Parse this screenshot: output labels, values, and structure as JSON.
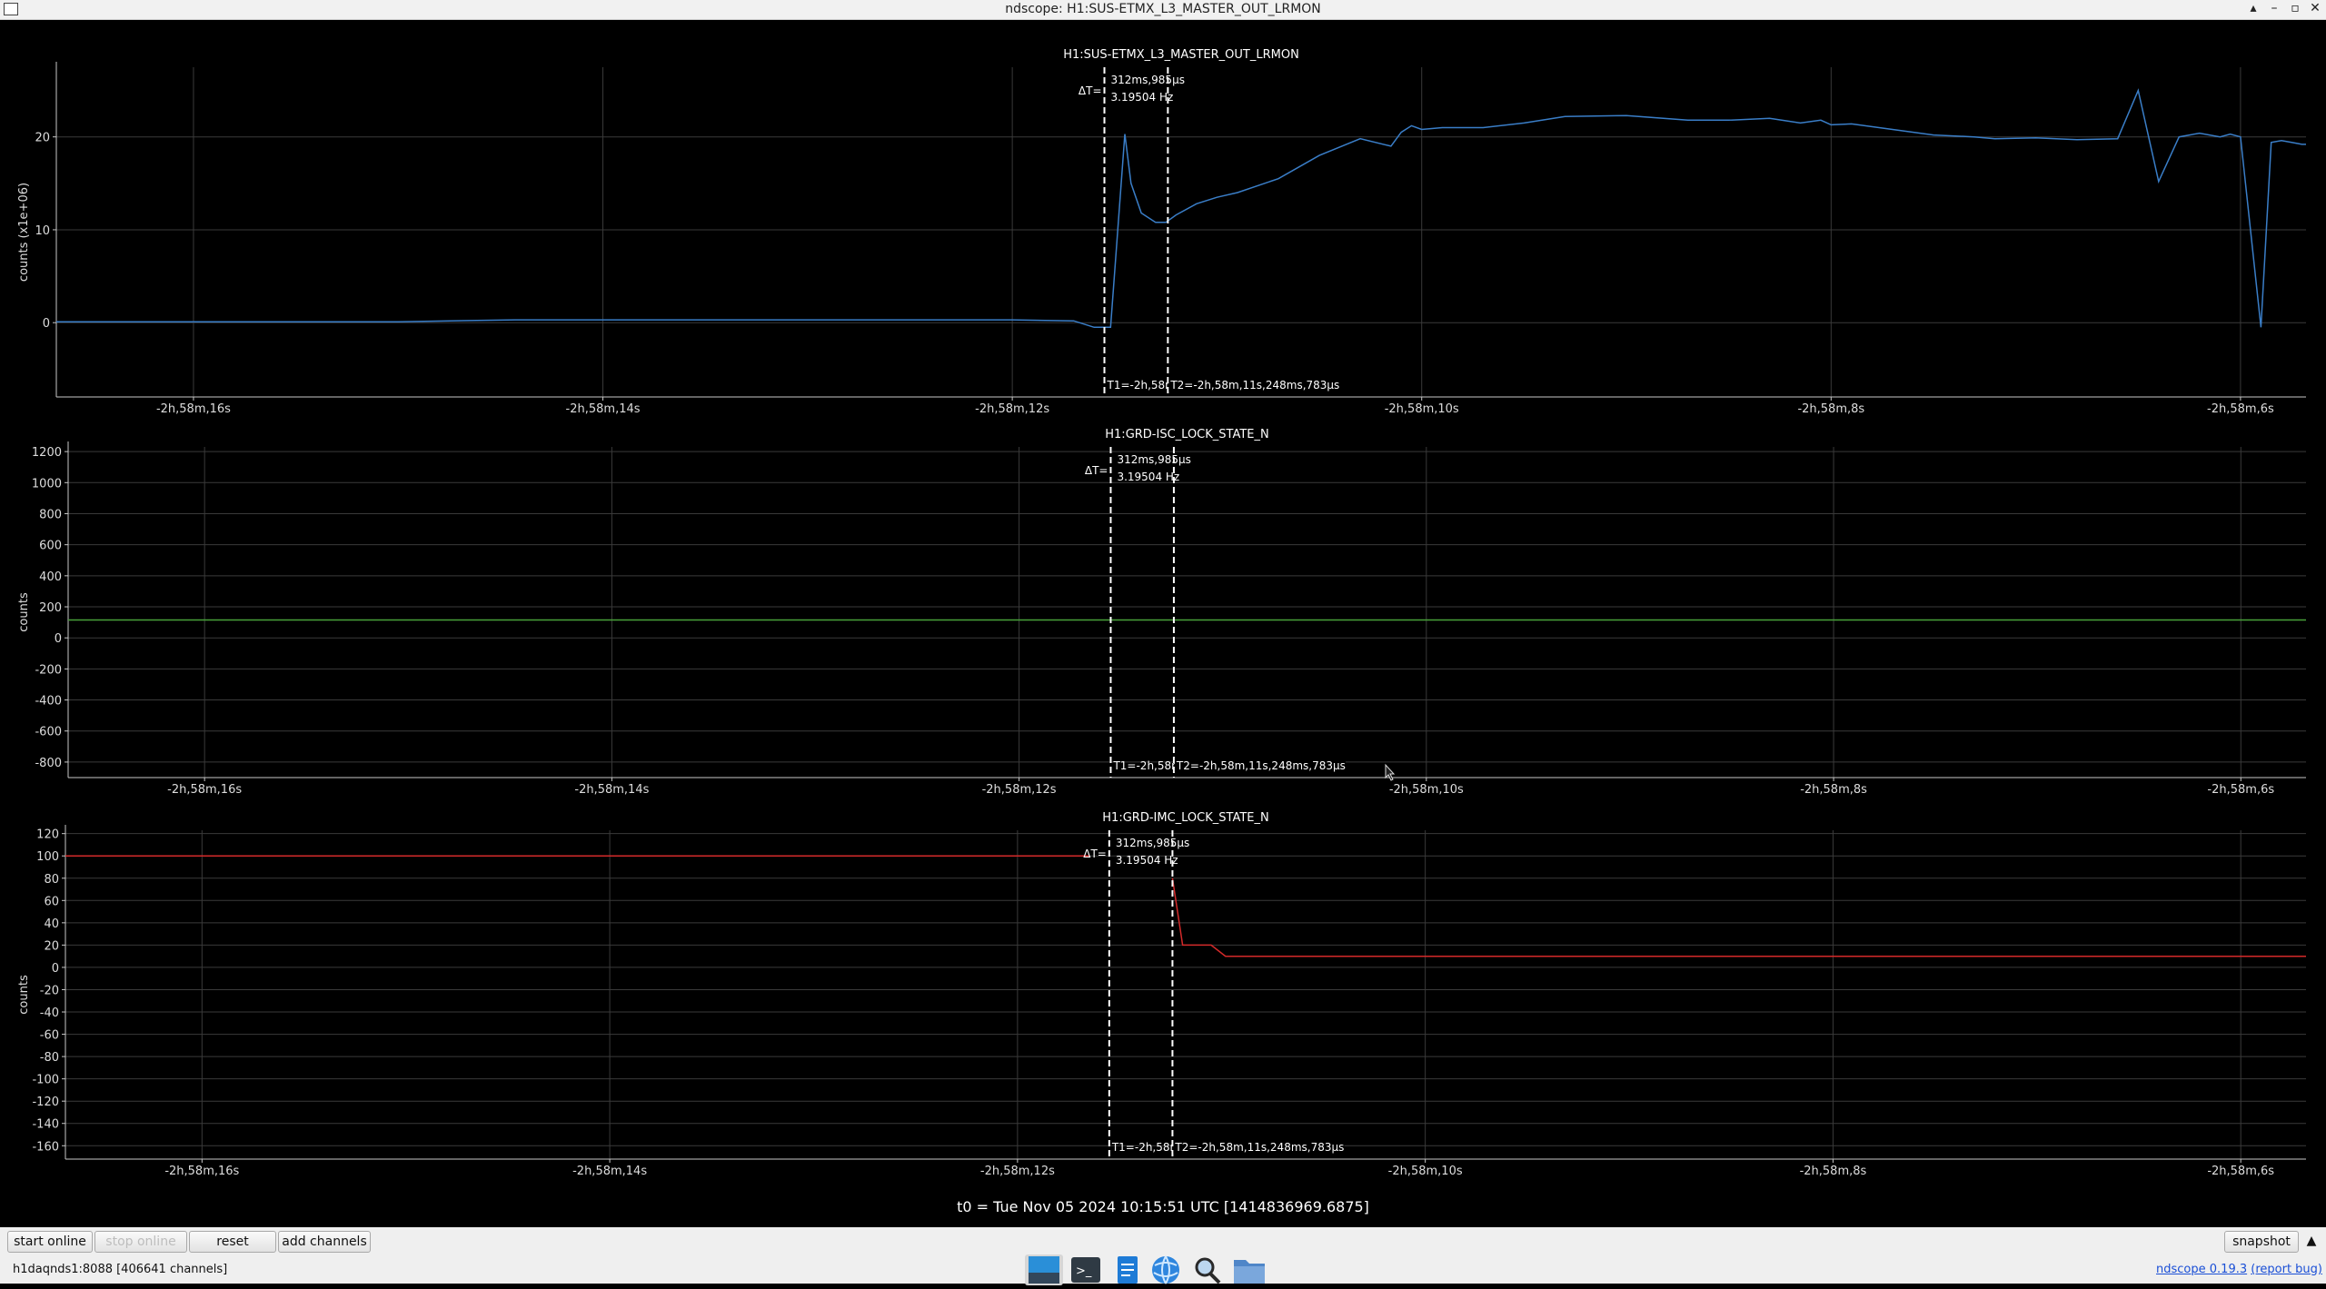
{
  "window": {
    "title": "ndscope: H1:SUS-ETMX_L3_MASTER_OUT_LRMON",
    "controls": [
      "▴",
      "–",
      "▫",
      "✕"
    ]
  },
  "plots": [
    {
      "channel": "H1:SUS-ETMX_L3_MASTER_OUT_LRMON",
      "ylabel": "counts (x1e+06)",
      "ylim": [
        -8,
        27.5
      ],
      "yticks": [
        0,
        10,
        20
      ],
      "color": "#3a7ec8",
      "cursor_delta": "312ms,985µs",
      "cursor_freq": "3.19504 Hz",
      "cursor_delta_label": "ΔT=",
      "t1_label": "T1=-2h,58m",
      "t2_label": "T2=-2h,58m,11s,248ms,783µs"
    },
    {
      "channel": "H1:GRD-ISC_LOCK_STATE_N",
      "ylabel": "counts",
      "ylim": [
        -900,
        1230
      ],
      "yticks": [
        1200,
        1000,
        800,
        600,
        400,
        200,
        0,
        -200,
        -400,
        -600,
        -800
      ],
      "color": "#49a23a",
      "cursor_delta": "312ms,985µs",
      "cursor_freq": "3.19504 Hz",
      "cursor_delta_label": "ΔT=",
      "t1_label": "T1=-2h,58m",
      "t2_label": "T2=-2h,58m,11s,248ms,783µs"
    },
    {
      "channel": "H1:GRD-IMC_LOCK_STATE_N",
      "ylabel": "counts",
      "ylim": [
        -172,
        123
      ],
      "yticks": [
        120,
        100,
        80,
        60,
        40,
        20,
        0,
        -20,
        -40,
        -60,
        -80,
        -100,
        -120,
        -140,
        -160
      ],
      "color": "#d42a2a",
      "cursor_delta": "312ms,985µs",
      "cursor_freq": "3.19504 Hz",
      "cursor_delta_label": "ΔT=",
      "t1_label": "T1=-2h,58m",
      "t2_label": "T2=-2h,58m,11s,248ms,783µs"
    }
  ],
  "chart_data": [
    {
      "type": "line",
      "title": "H1:SUS-ETMX_L3_MASTER_OUT_LRMON",
      "xlabel": "",
      "ylabel": "counts (x1e+06)",
      "xlim": [
        -16.67,
        -5.68
      ],
      "ylim": [
        -8,
        27.5
      ],
      "grid": true,
      "xticks": [
        -16,
        -14,
        -12,
        -10,
        -8,
        -6
      ],
      "xtick_labels": [
        "-2h,58m,16s",
        "-2h,58m,14s",
        "-2h,58m,12s",
        "-2h,58m,10s",
        "-2h,58m,8s",
        "-2h,58m,6s"
      ],
      "yticks": [
        0,
        10,
        20
      ],
      "cursors_x": [
        -11.55,
        -11.24
      ],
      "series": [
        {
          "x": [
            -16.67,
            -15.0,
            -14.43,
            -13.5,
            -12.0,
            -11.7,
            -11.6,
            -11.52,
            -11.45,
            -11.42,
            -11.37,
            -11.3,
            -11.25,
            -11.2,
            -11.1,
            -11.0,
            -10.9,
            -10.7,
            -10.5,
            -10.3,
            -10.15,
            -10.1,
            -10.05,
            -10.0,
            -9.9,
            -9.7,
            -9.5,
            -9.3,
            -9.0,
            -8.7,
            -8.5,
            -8.3,
            -8.15,
            -8.05,
            -8.0,
            -7.9,
            -7.7,
            -7.5,
            -7.3,
            -7.2,
            -7.0,
            -6.8,
            -6.6,
            -6.5,
            -6.4,
            -6.3,
            -6.2,
            -6.1,
            -6.05,
            -6.0,
            -5.9,
            -5.85,
            -5.8,
            -5.75,
            -5.7,
            -5.68
          ],
          "y": [
            0.1,
            0.1,
            0.3,
            0.3,
            0.3,
            0.2,
            -0.5,
            -0.5,
            20.3,
            15.0,
            11.8,
            10.8,
            10.8,
            11.6,
            12.8,
            13.5,
            14.0,
            15.5,
            18.0,
            19.8,
            19.0,
            20.5,
            21.2,
            20.8,
            21.0,
            21.0,
            21.5,
            22.2,
            22.3,
            21.8,
            21.8,
            22.0,
            21.5,
            21.8,
            21.3,
            21.4,
            20.8,
            20.2,
            20.0,
            19.8,
            19.9,
            19.7,
            19.8,
            25.0,
            15.2,
            20.0,
            20.4,
            20.0,
            20.3,
            20.0,
            -0.5,
            19.4,
            19.6,
            19.4,
            19.2,
            19.2
          ]
        }
      ]
    },
    {
      "type": "line",
      "title": "H1:GRD-ISC_LOCK_STATE_N",
      "xlabel": "",
      "ylabel": "counts",
      "xlim": [
        -16.67,
        -5.68
      ],
      "ylim": [
        -900,
        1230
      ],
      "grid": true,
      "xticks": [
        -16,
        -14,
        -12,
        -10,
        -8,
        -6
      ],
      "xtick_labels": [
        "-2h,58m,16s",
        "-2h,58m,14s",
        "-2h,58m,12s",
        "-2h,58m,10s",
        "-2h,58m,8s",
        "-2h,58m,6s"
      ],
      "yticks": [
        1200,
        1000,
        800,
        600,
        400,
        200,
        0,
        -200,
        -400,
        -600,
        -800
      ],
      "cursors_x": [
        -11.55,
        -11.24
      ],
      "series": [
        {
          "x": [
            -16.67,
            -5.68
          ],
          "y": [
            115,
            115
          ]
        }
      ]
    },
    {
      "type": "line",
      "title": "H1:GRD-IMC_LOCK_STATE_N",
      "xlabel": "",
      "ylabel": "counts",
      "xlim": [
        -16.67,
        -5.68
      ],
      "ylim": [
        -172,
        123
      ],
      "grid": true,
      "xticks": [
        -16,
        -14,
        -12,
        -10,
        -8,
        -6
      ],
      "xtick_labels": [
        "-2h,58m,16s",
        "-2h,58m,14s",
        "-2h,58m,12s",
        "-2h,58m,10s",
        "-2h,58m,8s",
        "-2h,58m,6s"
      ],
      "yticks": [
        120,
        100,
        80,
        60,
        40,
        20,
        0,
        -20,
        -40,
        -60,
        -80,
        -100,
        -120,
        -140,
        -160
      ],
      "cursors_x": [
        -11.55,
        -11.24
      ],
      "series": [
        {
          "x": [
            -16.67,
            -11.65
          ],
          "y": [
            100,
            100
          ]
        },
        {
          "x": [
            -11.24,
            -11.19,
            -11.15,
            -11.05,
            -10.98,
            -5.68
          ],
          "y": [
            80,
            20,
            20,
            20,
            10,
            10
          ]
        }
      ]
    }
  ],
  "status": {
    "t0": "t0 = Tue Nov 05 2024 10:15:51 UTC [1414836969.6875]",
    "server": "h1daqnds1:8088  [406641 channels]",
    "version_link": "ndscope 0.19.3",
    "report_link": "(report bug)"
  },
  "controls": {
    "start_online": "start online",
    "stop_online": "stop online",
    "reset": "reset",
    "add_channels": "add channels",
    "snapshot": "snapshot",
    "collapse": "▲"
  }
}
